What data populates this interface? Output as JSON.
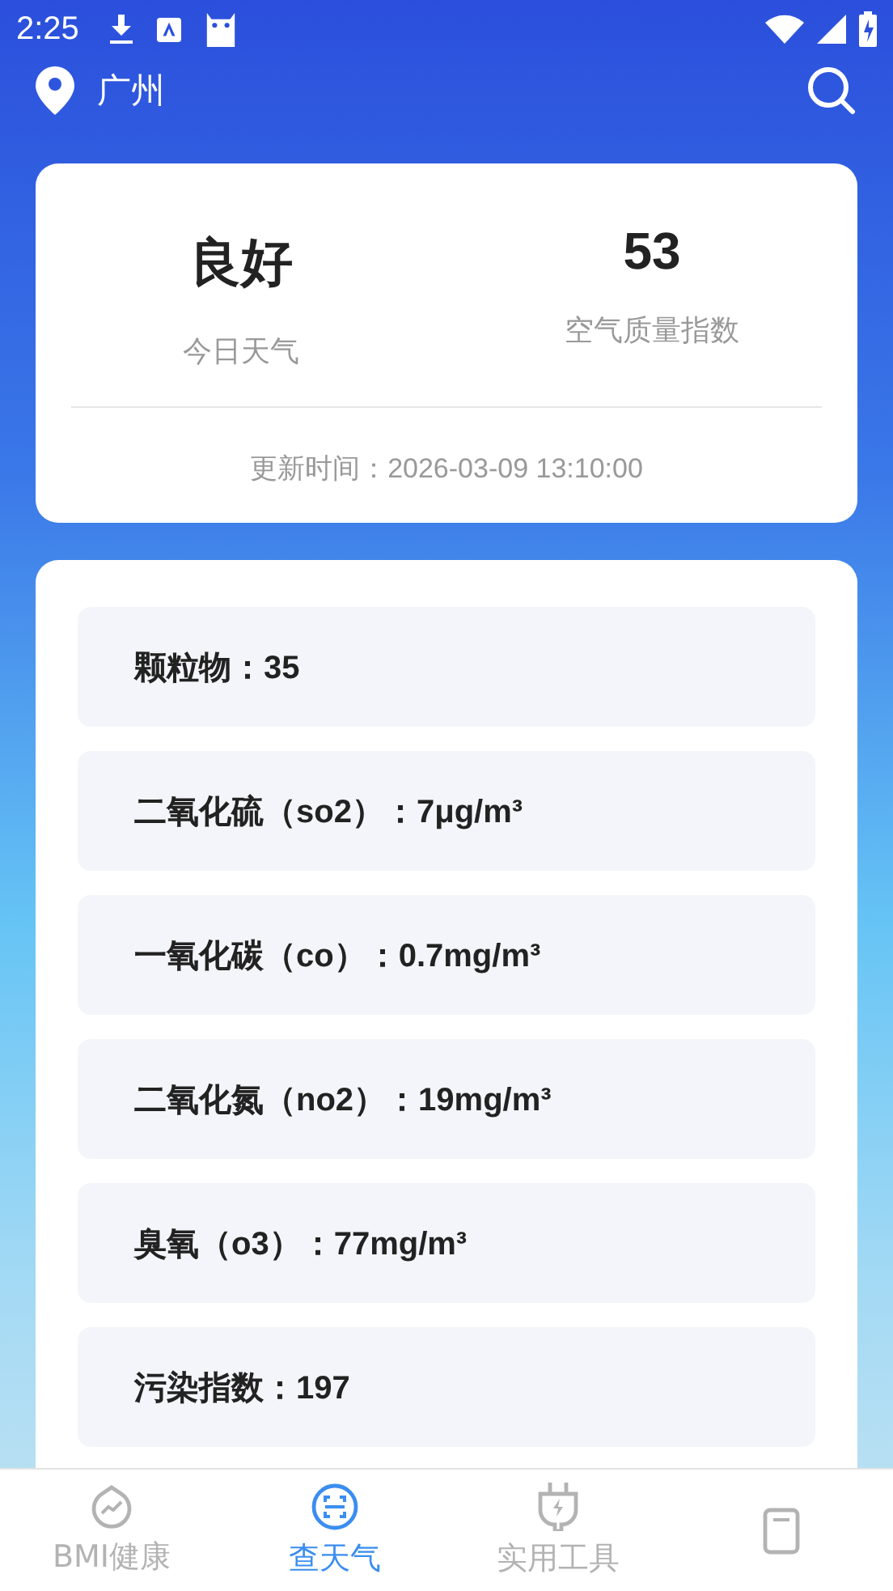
{
  "status_bar": {
    "time": "2:25"
  },
  "header": {
    "city": "广州"
  },
  "summary": {
    "quality": "良好",
    "quality_label": "今日天气",
    "aqi": "53",
    "aqi_label": "空气质量指数",
    "updated": "更新时间：2026-03-09 13:10:00"
  },
  "pollutants": [
    "颗粒物：35",
    "二氧化硫（so2）：7μg/m³",
    "一氧化碳（co）：0.7mg/m³",
    "二氧化氮（no2）：19mg/m³",
    "臭氧（o3）：77mg/m³",
    "污染指数：197"
  ],
  "nav": [
    {
      "kind": "health",
      "label": "BMI健康",
      "selected": false
    },
    {
      "kind": "weather",
      "label": "查天气",
      "selected": true
    },
    {
      "kind": "tools",
      "label": "实用工具",
      "selected": false
    },
    {
      "kind": "phone",
      "selected": false
    }
  ]
}
